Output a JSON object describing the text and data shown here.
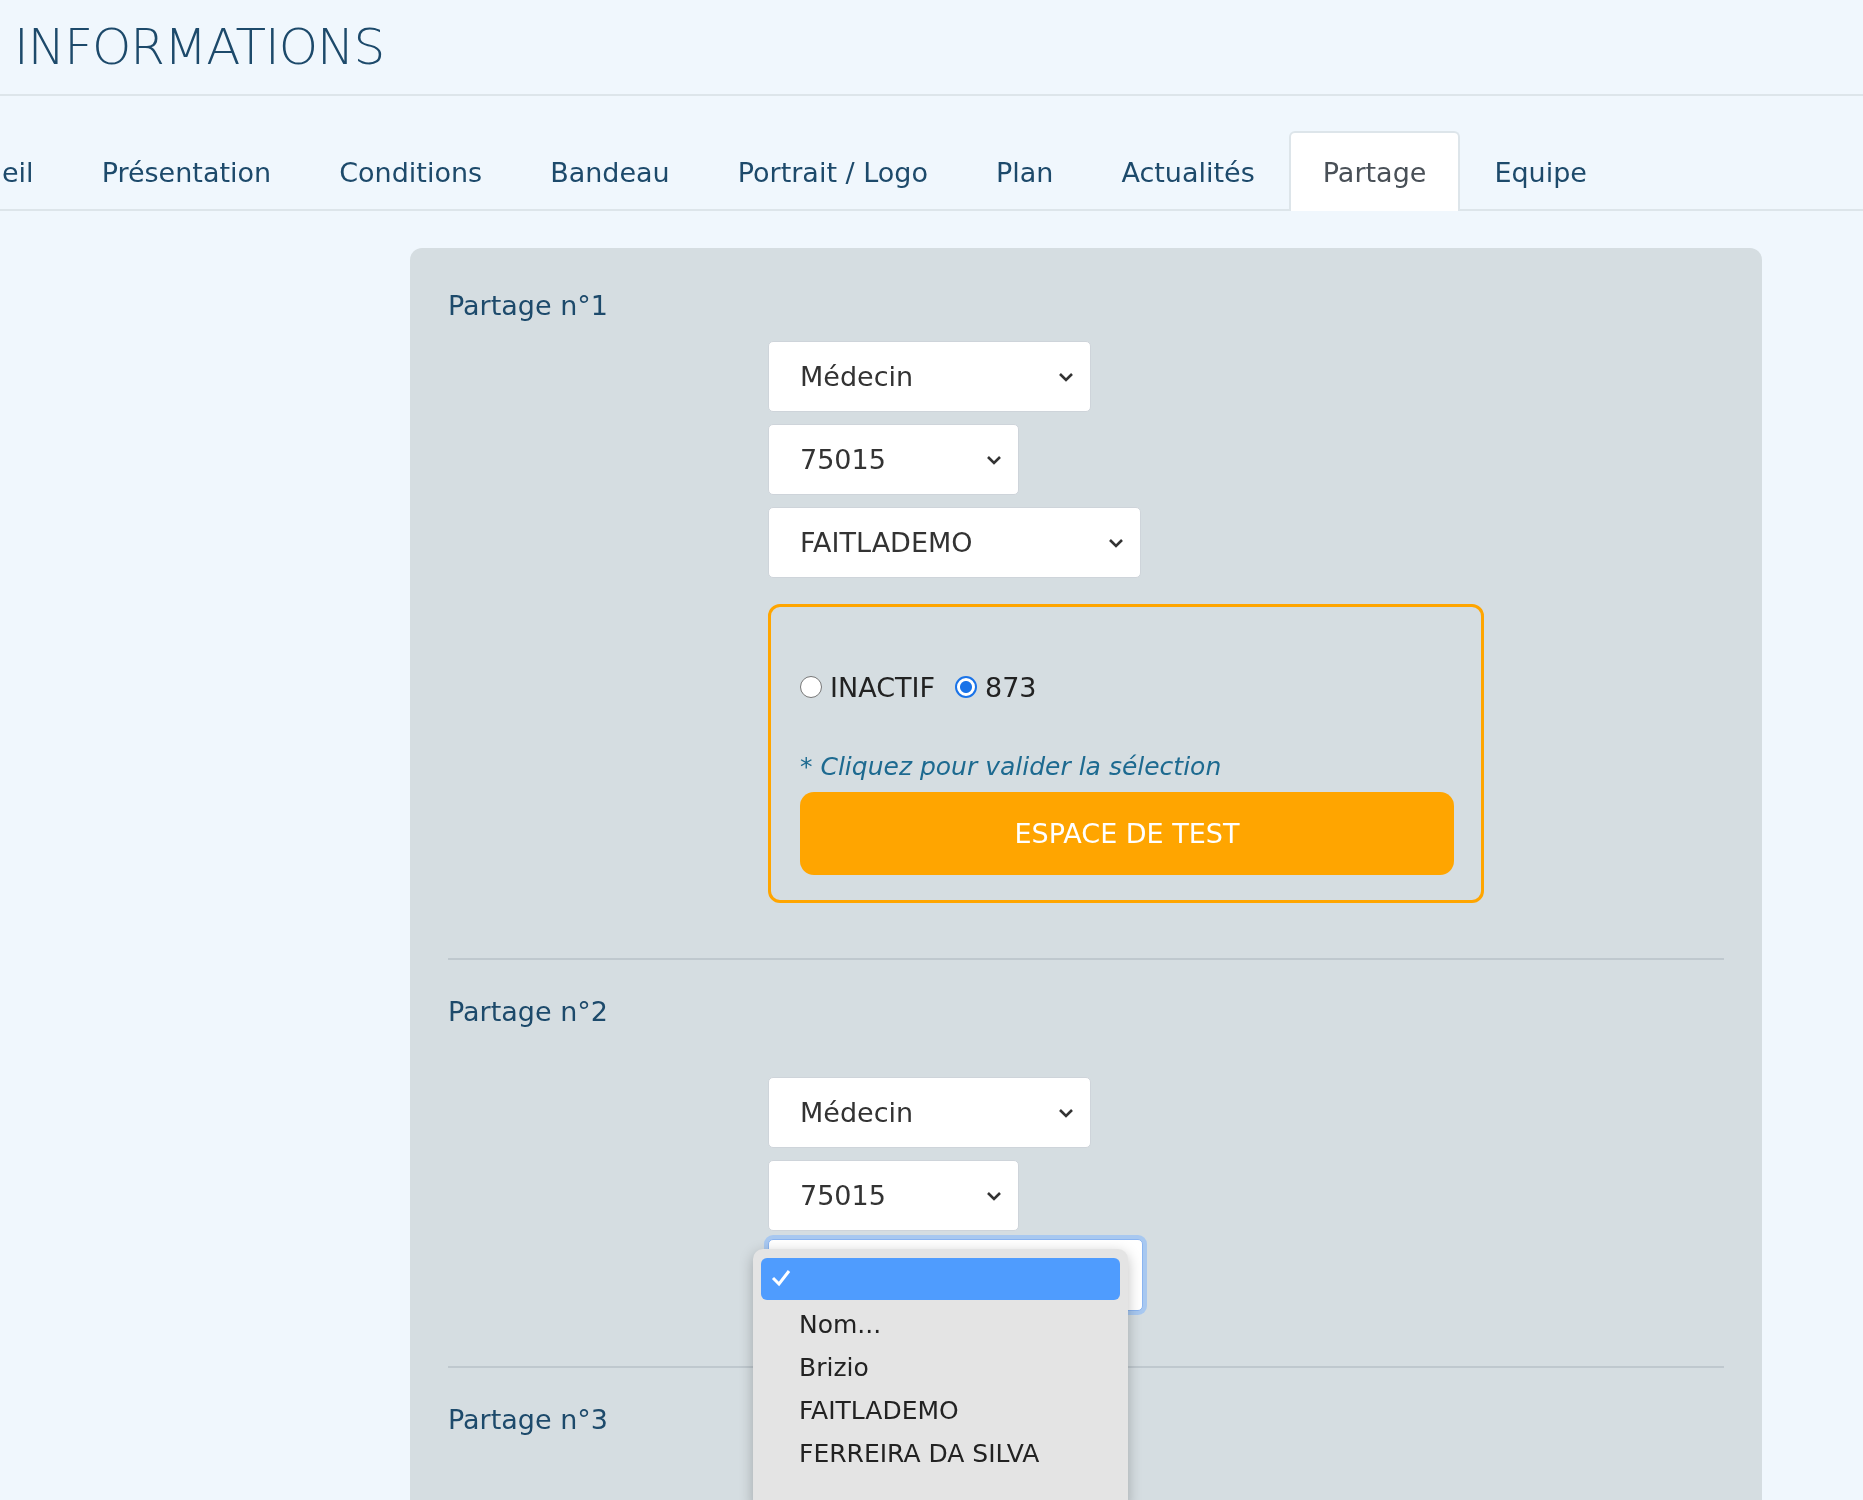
{
  "header": {
    "title": "INFORMATIONS"
  },
  "tabs": [
    {
      "label": "eil",
      "selected": false
    },
    {
      "label": "Présentation",
      "selected": false
    },
    {
      "label": "Conditions",
      "selected": false
    },
    {
      "label": "Bandeau",
      "selected": false
    },
    {
      "label": "Portrait / Logo",
      "selected": false
    },
    {
      "label": "Plan",
      "selected": false
    },
    {
      "label": "Actualités",
      "selected": false
    },
    {
      "label": "Partage",
      "selected": true
    },
    {
      "label": "Equipe",
      "selected": false
    }
  ],
  "shares": [
    {
      "title": "Partage n°1",
      "selects": [
        {
          "value": "Médecin"
        },
        {
          "value": "75015"
        },
        {
          "value": "FAITLADEMO"
        }
      ],
      "choice": {
        "radios": [
          {
            "label": "INACTIF",
            "selected": false
          },
          {
            "label": "873",
            "selected": true
          }
        ],
        "hint": "* Cliquez pour valider la sélection",
        "button": "ESPACE DE TEST"
      }
    },
    {
      "title": "Partage n°2",
      "selects": [
        {
          "value": "Médecin"
        },
        {
          "value": "75015"
        },
        {
          "focused": true,
          "menu": [
            {
              "selected": true
            },
            {
              "label": "Nom...",
              "selected": false
            },
            {
              "label": "Brizio",
              "selected": false
            },
            {
              "label": "FAITLADEMO",
              "selected": false
            },
            {
              "label": "FERREIRA DA SILVA",
              "selected": false
            }
          ]
        }
      ]
    },
    {
      "title": "Partage n°3"
    }
  ]
}
